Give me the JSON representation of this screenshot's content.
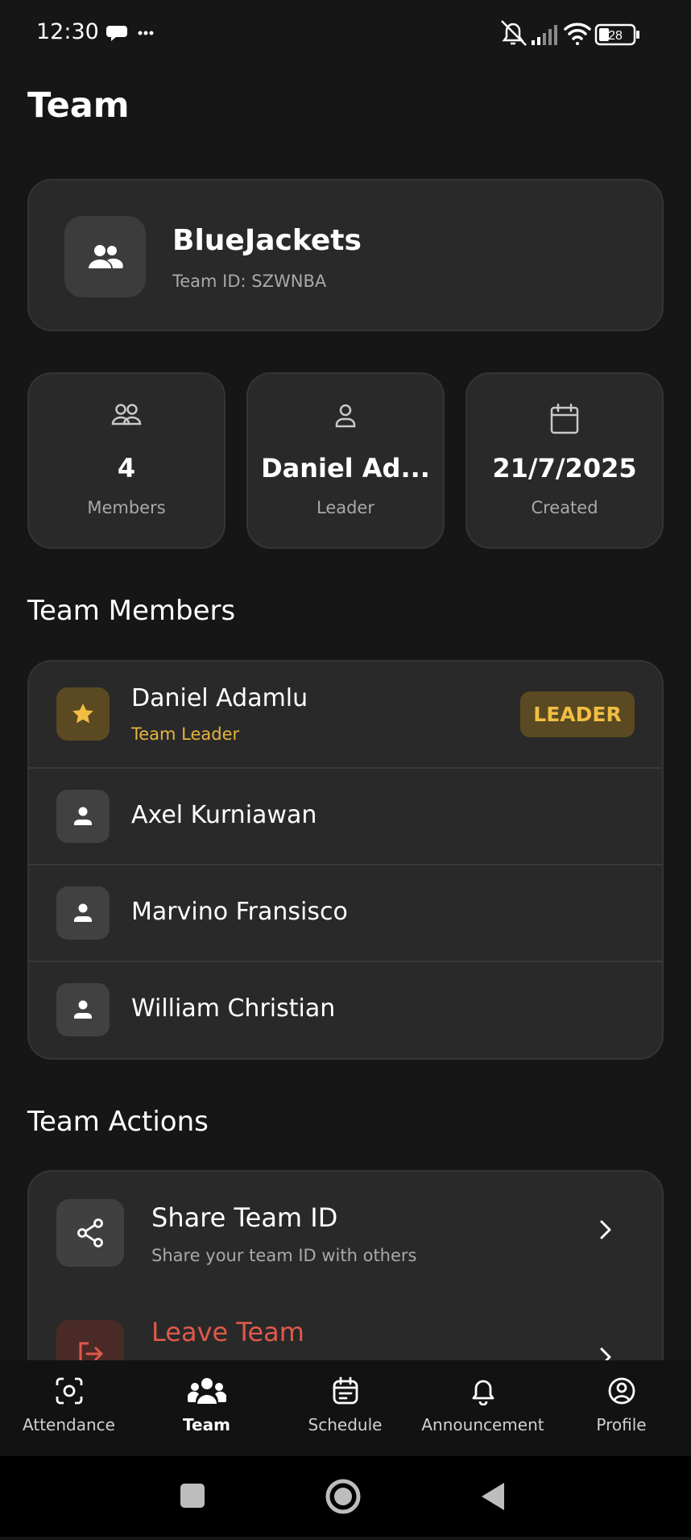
{
  "status_bar": {
    "time": "12:30",
    "battery": "28"
  },
  "page": {
    "title": "Team"
  },
  "team": {
    "name": "BlueJackets",
    "team_id_label": "Team ID: SZWNBA"
  },
  "stats": [
    {
      "value": "4",
      "label": "Members",
      "icon": "members-icon"
    },
    {
      "value": "Daniel Ad...",
      "label": "Leader",
      "icon": "person-icon"
    },
    {
      "value": "21/7/2025",
      "label": "Created",
      "icon": "calendar-icon"
    }
  ],
  "members_section": {
    "title": "Team Members",
    "members": [
      {
        "name": "Daniel Adamlu",
        "role": "Team Leader",
        "badge": "LEADER"
      },
      {
        "name": "Axel Kurniawan"
      },
      {
        "name": "Marvino Fransisco"
      },
      {
        "name": "William Christian"
      }
    ]
  },
  "actions_section": {
    "title": "Team Actions",
    "actions": [
      {
        "title": "Share Team ID",
        "subtitle": "Share your team ID with others"
      },
      {
        "title": "Leave Team"
      }
    ]
  },
  "bottom_nav": {
    "items": [
      {
        "label": "Attendance"
      },
      {
        "label": "Team"
      },
      {
        "label": "Schedule"
      },
      {
        "label": "Announcement"
      },
      {
        "label": "Profile"
      }
    ],
    "active": "Team"
  },
  "colors": {
    "background": "#161616",
    "card": "#292929",
    "accent": "#f2bd44",
    "danger": "#e0594a"
  }
}
